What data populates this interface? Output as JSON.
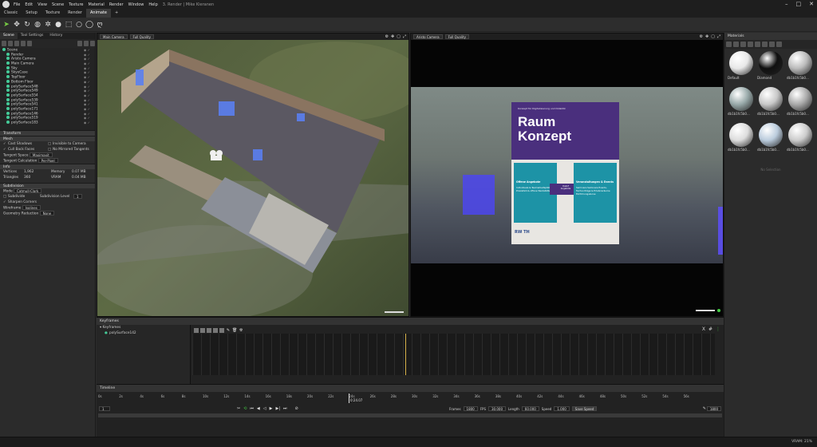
{
  "app": {
    "title": "3. Render | Mike Kieranen",
    "menu": [
      "File",
      "Edit",
      "View",
      "Scene",
      "Texture",
      "Material",
      "Render",
      "Window",
      "Help"
    ],
    "tabs": [
      "Classic",
      "Setup",
      "Texture",
      "Render",
      "Animate"
    ],
    "active_tab": "Animate",
    "add_tab": "+",
    "window_controls": [
      "–",
      "□",
      "✕"
    ]
  },
  "toolbar": {
    "tools": [
      "select-arrow",
      "move",
      "rotate",
      "globe",
      "orbit",
      "sphere-tool",
      "box-select",
      "circle",
      "circle-select",
      "lasso"
    ]
  },
  "left": {
    "tabs": [
      "Scene",
      "Tool Settings",
      "History"
    ],
    "active_tab": "Scene",
    "tree": [
      {
        "name": "Scene",
        "indent": 0
      },
      {
        "name": "Render",
        "indent": 1
      },
      {
        "name": "Aristo Camera",
        "indent": 1
      },
      {
        "name": "Main Camera",
        "indent": 1
      },
      {
        "name": "Sky",
        "indent": 1
      },
      {
        "name": "SkyeCase",
        "indent": 1
      },
      {
        "name": "TopFloor",
        "indent": 1
      },
      {
        "name": "Bottom Floor",
        "indent": 1
      },
      {
        "name": "polySurface548",
        "indent": 1
      },
      {
        "name": "polySurface549",
        "indent": 1
      },
      {
        "name": "polySurface554",
        "indent": 1
      },
      {
        "name": "polySurface539",
        "indent": 1
      },
      {
        "name": "polySurface541",
        "indent": 1
      },
      {
        "name": "polySurface171",
        "indent": 1
      },
      {
        "name": "polySurface146",
        "indent": 1
      },
      {
        "name": "polySurface519",
        "indent": 1
      },
      {
        "name": "polySurface183",
        "indent": 1
      }
    ],
    "transform_label": "Transform",
    "mesh_label": "Mesh",
    "cast_shadows": "Cast Shadows",
    "invisible_camera": "Invisible to Camera",
    "cull_back": "Cull Back Faces",
    "no_mirrored": "No Mirrored Tangents",
    "tangent_space_label": "Tangent Space",
    "tangent_space_value": "Maximaxit",
    "tangent_calc_label": "Tangent Calculation",
    "tangent_calc_value": "Per-Pixel",
    "info_label": "Info",
    "vertices_label": "Vertices",
    "vertices_value": "1,962",
    "memory_label": "Memory",
    "memory_value": "0.07 MB",
    "triangles_label": "Triangles",
    "triangles_value": "360",
    "vram_label": "VRAM",
    "vram_value": "0.04 MB",
    "subdivision_label": "Subdivision",
    "mode_label": "Mode",
    "mode_value": "Catmull-Clark",
    "subdivide_label": "Subdivide",
    "subdiv_level_label": "Subdivision Level",
    "subdiv_level_value": "1",
    "sharpen_label": "Sharpen Corners",
    "wireframe_label": "Wireframe",
    "wireframe_value": "Isolines",
    "geometry_label": "Geometry Reduction",
    "geometry_value": "None"
  },
  "viewport_left": {
    "camera": "Main Camera",
    "quality": "Full Quality"
  },
  "viewport_right": {
    "camera": "Aristo Camera",
    "quality": "Full Quality",
    "poster": {
      "top_text": "Konzept für Digitalisierung und Didaktik",
      "title_1": "Raum",
      "title_2": "Konzept",
      "left_box_title": "Offene Angebote",
      "left_box_body": "Individuale & Teamarbeitsplätze Praxisfeld & offene Werkstätten",
      "arrow_top": "Dakof",
      "arrow_bottom": "Angebote",
      "right_box_title": "Veranstaltungen & Events",
      "right_box_body": "Seminare Seminare Events, Fachvorträge & Erlebnisräume Einführungskurse",
      "logo": "RW TH"
    }
  },
  "materials": {
    "title": "Materials",
    "empty": "No Selection",
    "items": [
      {
        "name": "Default",
        "color": "#e8e8e8"
      },
      {
        "name": "Diamond",
        "color": "#101010"
      },
      {
        "name": "db1b1fc5b0...",
        "color": "#bbb"
      },
      {
        "name": "db1b1fc5b0...",
        "color": "#9aa"
      },
      {
        "name": "db1b1fc5b0...",
        "color": "#c8c8c8"
      },
      {
        "name": "db1b1fc5b0...",
        "color": "#aaa"
      },
      {
        "name": "db1b1fc5b0...",
        "color": "#ddd"
      },
      {
        "name": "db1b1fc5b0...",
        "color": "#bcd"
      },
      {
        "name": "db1b1fc5b0...",
        "color": "#ccc"
      }
    ]
  },
  "keyframes": {
    "title": "Keyframes",
    "root": "Keyframes",
    "child": "polySurface142",
    "tools": [
      "X",
      "#",
      "⋮"
    ]
  },
  "timeline": {
    "title": "Timeline",
    "ticks": [
      "0s",
      "2s",
      "4s",
      "6s",
      "8s",
      "10s",
      "12s",
      "14s",
      "16s",
      "18s",
      "20s",
      "22s",
      "24s",
      "26s",
      "28s",
      "30s",
      "32s",
      "34s",
      "36s",
      "38s",
      "40s",
      "42s",
      "44s",
      "46s",
      "48s",
      "50s",
      "52s",
      "54s",
      "56s"
    ],
    "current_time": "0:24.07",
    "start_field": "1",
    "frames_label": "Frames",
    "frames_value": "1800",
    "fps_label": "FPS",
    "fps_value": "30.000",
    "length_label": "Length",
    "length_value": "60.000",
    "speed_label": "Speed",
    "speed_value": "1.000",
    "save_speed": "Save Speed",
    "end_field": "1800"
  },
  "status": {
    "vram": "VRAM: 21%"
  }
}
